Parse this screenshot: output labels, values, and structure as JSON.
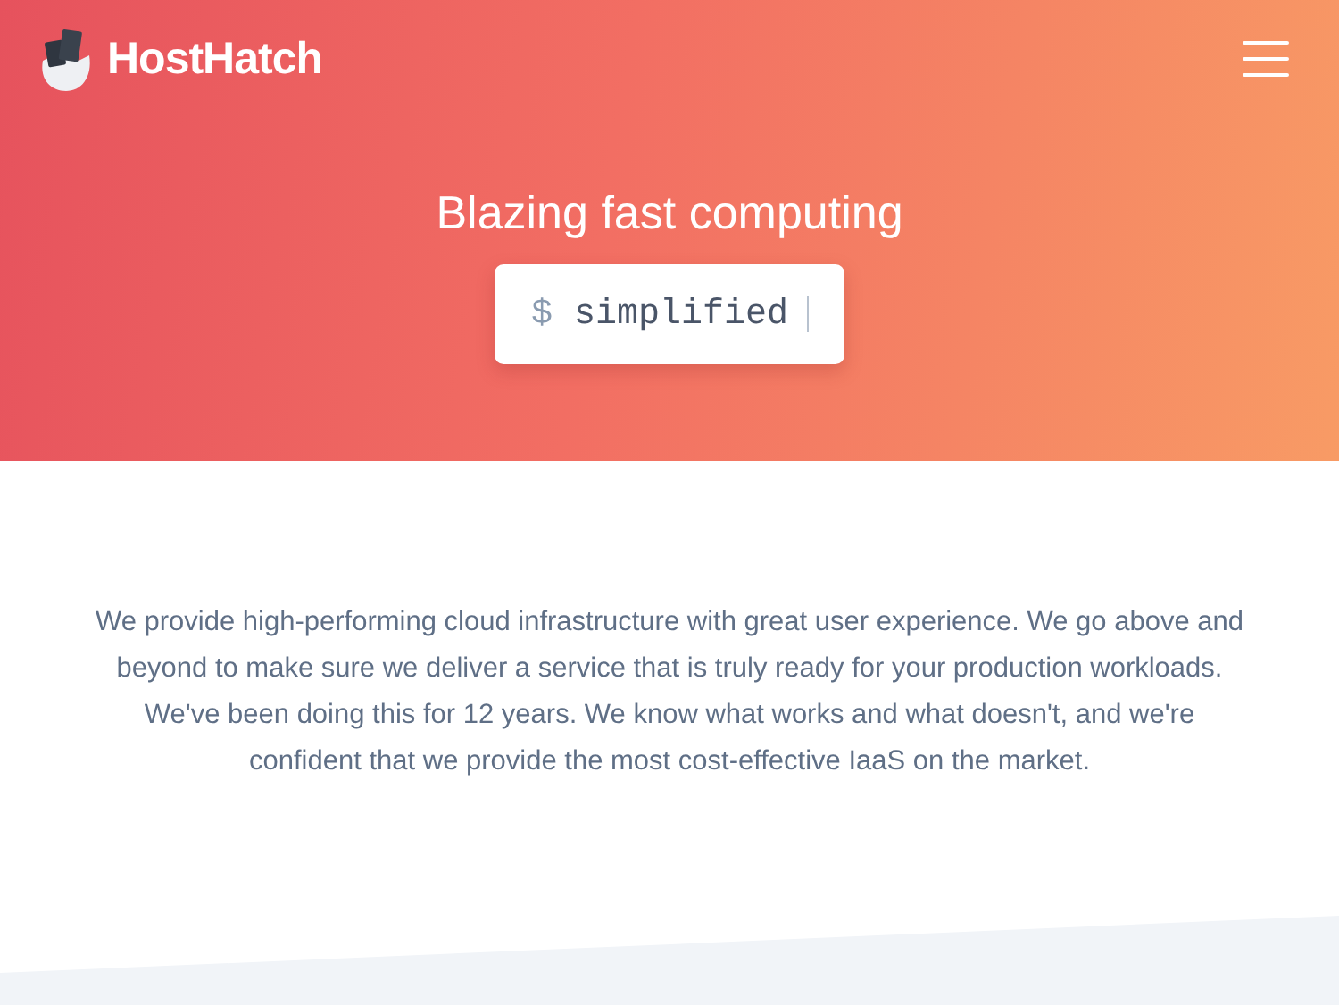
{
  "header": {
    "brand": "HostHatch"
  },
  "hero": {
    "title": "Blazing fast computing",
    "prompt": "$",
    "typed": "simplified"
  },
  "intro": {
    "text": "We provide high-performing cloud infrastructure with great user experience. We go above and beyond to make sure we deliver a service that is truly ready for your production workloads. We've been doing this for 12 years. We know what works and what doesn't, and we're confident that we provide the most cost-effective IaaS on the market."
  }
}
